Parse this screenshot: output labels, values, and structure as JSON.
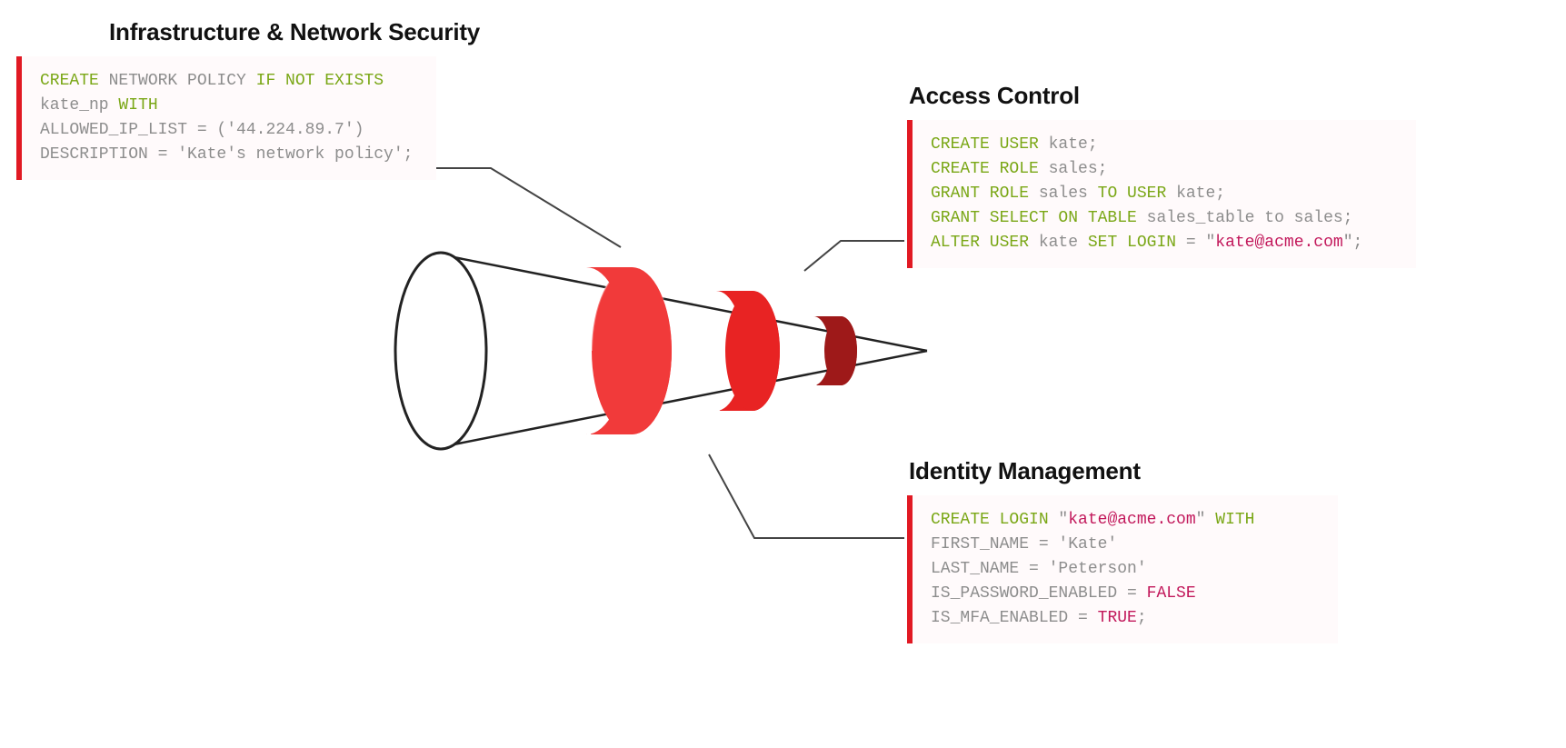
{
  "sections": {
    "infra": {
      "title": "Infrastructure & Network Security",
      "code": {
        "l1_create": "CREATE",
        "l1_rest": " NETWORK POLICY ",
        "l1_ifnot": "IF NOT EXISTS",
        "l2_name": "kate_np ",
        "l2_with": "WITH",
        "l3": "ALLOWED_IP_LIST = ('44.224.89.7')",
        "l4": "DESCRIPTION = 'Kate's network policy';"
      }
    },
    "access": {
      "title": "Access Control",
      "code": {
        "l1_a": "CREATE USER",
        "l1_b": " kate;",
        "l2_a": "CREATE ROLE",
        "l2_b": " sales;",
        "l3_a": "GRANT ROLE",
        "l3_b": " sales ",
        "l3_c": "TO USER",
        "l3_d": " kate;",
        "l4_a": "GRANT SELECT ON TABLE",
        "l4_b": " sales_table to sales;",
        "l5_a": "ALTER USER",
        "l5_b": " kate ",
        "l5_c": "SET LOGIN",
        "l5_d": " = \"",
        "l5_e": "kate@acme.com",
        "l5_f": "\";"
      }
    },
    "identity": {
      "title": "Identity Management",
      "code": {
        "l1_a": "CREATE LOGIN",
        "l1_b": " \"",
        "l1_c": "kate@acme.com",
        "l1_d": "\" ",
        "l1_e": "WITH",
        "l2": "FIRST_NAME = 'Kate'",
        "l3": "LAST_NAME = 'Peterson'",
        "l4_a": "IS_PASSWORD_ENABLED = ",
        "l4_b": "FALSE",
        "l5_a": "IS_MFA_ENABLED = ",
        "l5_b": "TRUE",
        "l5_c": ";"
      }
    }
  }
}
